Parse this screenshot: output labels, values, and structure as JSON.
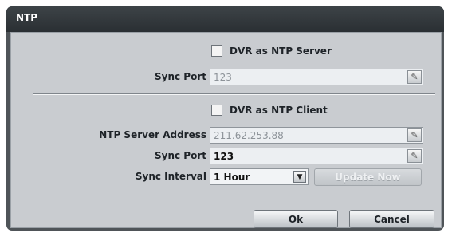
{
  "dialog": {
    "title": "NTP",
    "server": {
      "checkbox_label": "DVR as NTP Server",
      "checked": false,
      "sync_port_label": "Sync Port",
      "sync_port_value": "123"
    },
    "client": {
      "checkbox_label": "DVR as NTP Client",
      "checked": false,
      "server_address_label": "NTP Server Address",
      "server_address_value": "211.62.253.88",
      "sync_port_label": "Sync Port",
      "sync_port_value": "123",
      "sync_interval_label": "Sync Interval",
      "sync_interval_value": "1 Hour",
      "update_now_label": "Update Now"
    },
    "ok_label": "Ok",
    "cancel_label": "Cancel"
  },
  "icons": {
    "edit": "pencil-icon",
    "dropdown": "triangle-down-icon"
  }
}
